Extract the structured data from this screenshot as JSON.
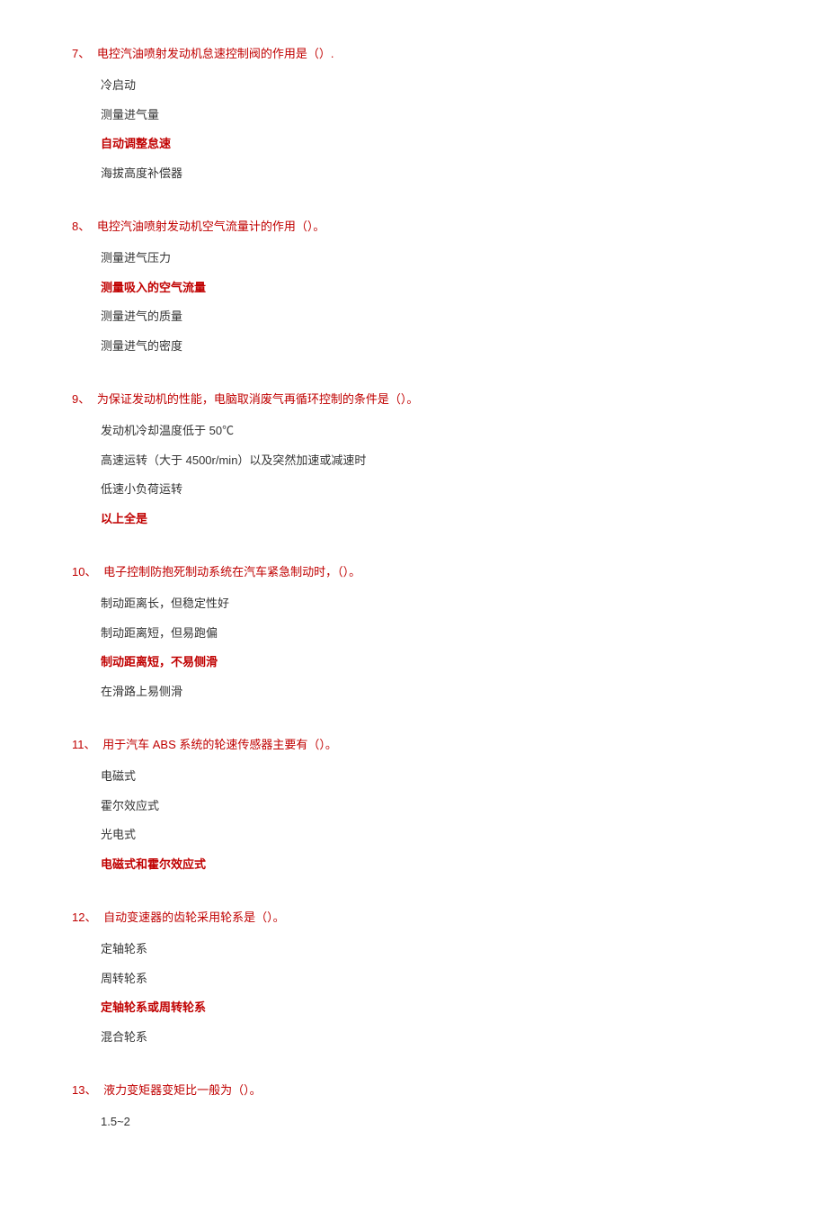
{
  "questions": [
    {
      "num": "7、",
      "text": "电控汽油喷射发动机怠速控制阀的作用是（）.",
      "options": [
        {
          "text": "冷启动",
          "correct": false
        },
        {
          "text": "测量进气量",
          "correct": false
        },
        {
          "text": "自动调整怠速",
          "correct": true
        },
        {
          "text": "海拔高度补偿器",
          "correct": false
        }
      ]
    },
    {
      "num": "8、",
      "text": "电控汽油喷射发动机空气流量计的作用（）。",
      "options": [
        {
          "text": "测量进气压力",
          "correct": false
        },
        {
          "text": "测量吸入的空气流量",
          "correct": true
        },
        {
          "text": "测量进气的质量",
          "correct": false
        },
        {
          "text": "测量进气的密度",
          "correct": false
        }
      ]
    },
    {
      "num": "9、",
      "text": "为保证发动机的性能，电脑取消废气再循环控制的条件是（）。",
      "options": [
        {
          "text": "发动机冷却温度低于 50℃",
          "correct": false
        },
        {
          "text": "高速运转（大于 4500r/min）以及突然加速或减速时",
          "correct": false
        },
        {
          "text": "低速小负荷运转",
          "correct": false
        },
        {
          "text": "以上全是",
          "correct": true
        }
      ]
    },
    {
      "num": "10、",
      "text": "电子控制防抱死制动系统在汽车紧急制动时，（）。",
      "options": [
        {
          "text": "制动距离长，但稳定性好",
          "correct": false
        },
        {
          "text": "制动距离短，但易跑偏",
          "correct": false
        },
        {
          "text": "制动距离短，不易侧滑",
          "correct": true
        },
        {
          "text": "在滑路上易侧滑",
          "correct": false
        }
      ]
    },
    {
      "num": "11、",
      "text": "用于汽车 ABS 系统的轮速传感器主要有（）。",
      "options": [
        {
          "text": "电磁式",
          "correct": false
        },
        {
          "text": "霍尔效应式",
          "correct": false
        },
        {
          "text": "光电式",
          "correct": false
        },
        {
          "text": "电磁式和霍尔效应式",
          "correct": true
        }
      ]
    },
    {
      "num": "12、",
      "text": "自动变速器的齿轮采用轮系是（）。",
      "options": [
        {
          "text": "定轴轮系",
          "correct": false
        },
        {
          "text": "周转轮系",
          "correct": false
        },
        {
          "text": "定轴轮系或周转轮系",
          "correct": true
        },
        {
          "text": "混合轮系",
          "correct": false
        }
      ]
    },
    {
      "num": "13、",
      "text": "液力变矩器变矩比一般为（）。",
      "options": [
        {
          "text": "1.5~2",
          "correct": false
        }
      ]
    }
  ]
}
